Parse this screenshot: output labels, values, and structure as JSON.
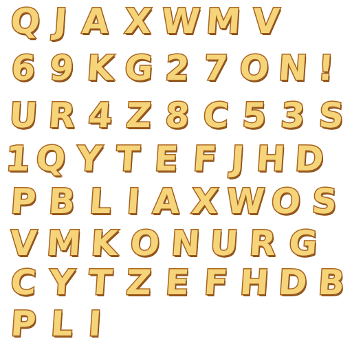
{
  "sheet": {
    "rows": [
      [
        "Q",
        "J",
        "A",
        "X",
        "W",
        "M",
        "V"
      ],
      [
        "6",
        "9",
        "K",
        "G",
        "2",
        "7",
        "O",
        "N",
        "!"
      ],
      [
        "U",
        "R",
        "4",
        "Z",
        "8",
        "C",
        "5",
        "3",
        "S"
      ],
      [
        "1",
        "Q",
        "Y",
        "T",
        "E",
        "F",
        "J",
        "H",
        "D"
      ],
      [
        "P",
        "B",
        "L",
        "I",
        "A",
        "X",
        "W",
        "O",
        "S"
      ],
      [
        "V",
        "M",
        "K",
        "O",
        "N",
        "U",
        "R",
        "G"
      ],
      [
        "C",
        "Y",
        "T",
        "Z",
        "E",
        "F",
        "H",
        "D",
        "B"
      ],
      [
        "P",
        "L",
        "I"
      ]
    ],
    "fill_color": "#f6d47a",
    "outline_color": "#b06a22",
    "background_color": "#ffffff"
  }
}
